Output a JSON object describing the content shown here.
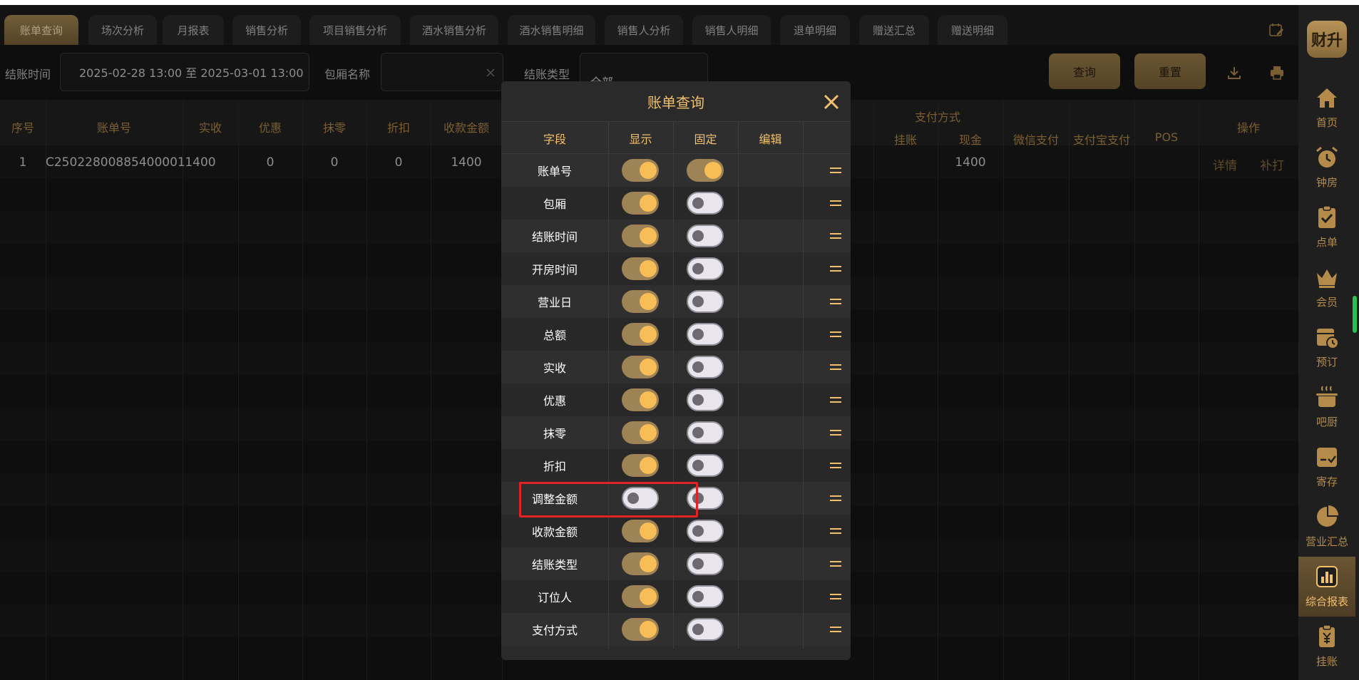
{
  "tabs": [
    {
      "label": "账单查询",
      "active": true
    },
    {
      "label": "场次分析"
    },
    {
      "label": "月报表"
    },
    {
      "label": "销售分析"
    },
    {
      "label": "项目销售分析"
    },
    {
      "label": "酒水销售分析"
    },
    {
      "label": "酒水销售明细"
    },
    {
      "label": "销售人分析"
    },
    {
      "label": "销售人明细"
    },
    {
      "label": "退单明细"
    },
    {
      "label": "赠送汇总"
    },
    {
      "label": "赠送明细"
    }
  ],
  "filters": {
    "checkout_time_label": "结账时间",
    "checkout_time_value": "2025-02-28 13:00 至 2025-03-01 13:00",
    "room_name_label": "包厢名称",
    "room_name_value": "",
    "checkout_type_label": "结账类型",
    "checkout_type_value": "全部",
    "query_button": "查询",
    "reset_button": "重置"
  },
  "table": {
    "headers": {
      "seq": "序号",
      "bill_no": "账单号",
      "actual": "实收",
      "discount": "优惠",
      "rounding": "抹零",
      "rebate": "折扣",
      "received": "收款金额",
      "payment_group": "支付方式",
      "credit": "挂账",
      "cash": "现金",
      "wechat": "微信支付",
      "alipay": "支付宝支付",
      "pos": "POS",
      "actions": "操作"
    },
    "rows": [
      {
        "seq": "1",
        "bill_no": "C25022800885400001",
        "actual": "1400",
        "discount": "0",
        "rounding": "0",
        "rebate": "0",
        "received": "1400",
        "cash": "1400",
        "detail": "详情",
        "reprint": "补打"
      }
    ]
  },
  "modal": {
    "title": "账单查询",
    "headers": {
      "field": "字段",
      "show": "显示",
      "fixed": "固定",
      "edit": "编辑"
    },
    "fields": [
      {
        "name": "账单号",
        "show": true,
        "fixed": true
      },
      {
        "name": "包厢",
        "show": true,
        "fixed": false
      },
      {
        "name": "结账时间",
        "show": true,
        "fixed": false
      },
      {
        "name": "开房时间",
        "show": true,
        "fixed": false
      },
      {
        "name": "营业日",
        "show": true,
        "fixed": false
      },
      {
        "name": "总额",
        "show": true,
        "fixed": false
      },
      {
        "name": "实收",
        "show": true,
        "fixed": false
      },
      {
        "name": "优惠",
        "show": true,
        "fixed": false
      },
      {
        "name": "抹零",
        "show": true,
        "fixed": false
      },
      {
        "name": "折扣",
        "show": true,
        "fixed": false
      },
      {
        "name": "调整金额",
        "show": false,
        "fixed": false
      },
      {
        "name": "收款金额",
        "show": true,
        "fixed": false
      },
      {
        "name": "结账类型",
        "show": true,
        "fixed": false
      },
      {
        "name": "订位人",
        "show": true,
        "fixed": false
      },
      {
        "name": "支付方式",
        "show": true,
        "fixed": false
      }
    ]
  },
  "sidebar": {
    "logo": "财升",
    "items": [
      {
        "label": "首页",
        "icon": "home-icon"
      },
      {
        "label": "钟房",
        "icon": "alarm-clock-icon"
      },
      {
        "label": "点单",
        "icon": "clipboard-check-icon"
      },
      {
        "label": "会员",
        "icon": "crown-icon"
      },
      {
        "label": "预订",
        "icon": "calendar-clock-icon"
      },
      {
        "label": "吧厨",
        "icon": "pot-icon"
      },
      {
        "label": "寄存",
        "icon": "storage-box-icon"
      },
      {
        "label": "营业汇总",
        "icon": "pie-chart-icon"
      },
      {
        "label": "综合报表",
        "icon": "bar-chart-icon",
        "active": true
      },
      {
        "label": "挂账",
        "icon": "yen-clipboard-icon"
      }
    ]
  },
  "colors": {
    "accent": "#f2c06c",
    "accent_dark": "#9d8355",
    "highlight": "#e02424"
  }
}
